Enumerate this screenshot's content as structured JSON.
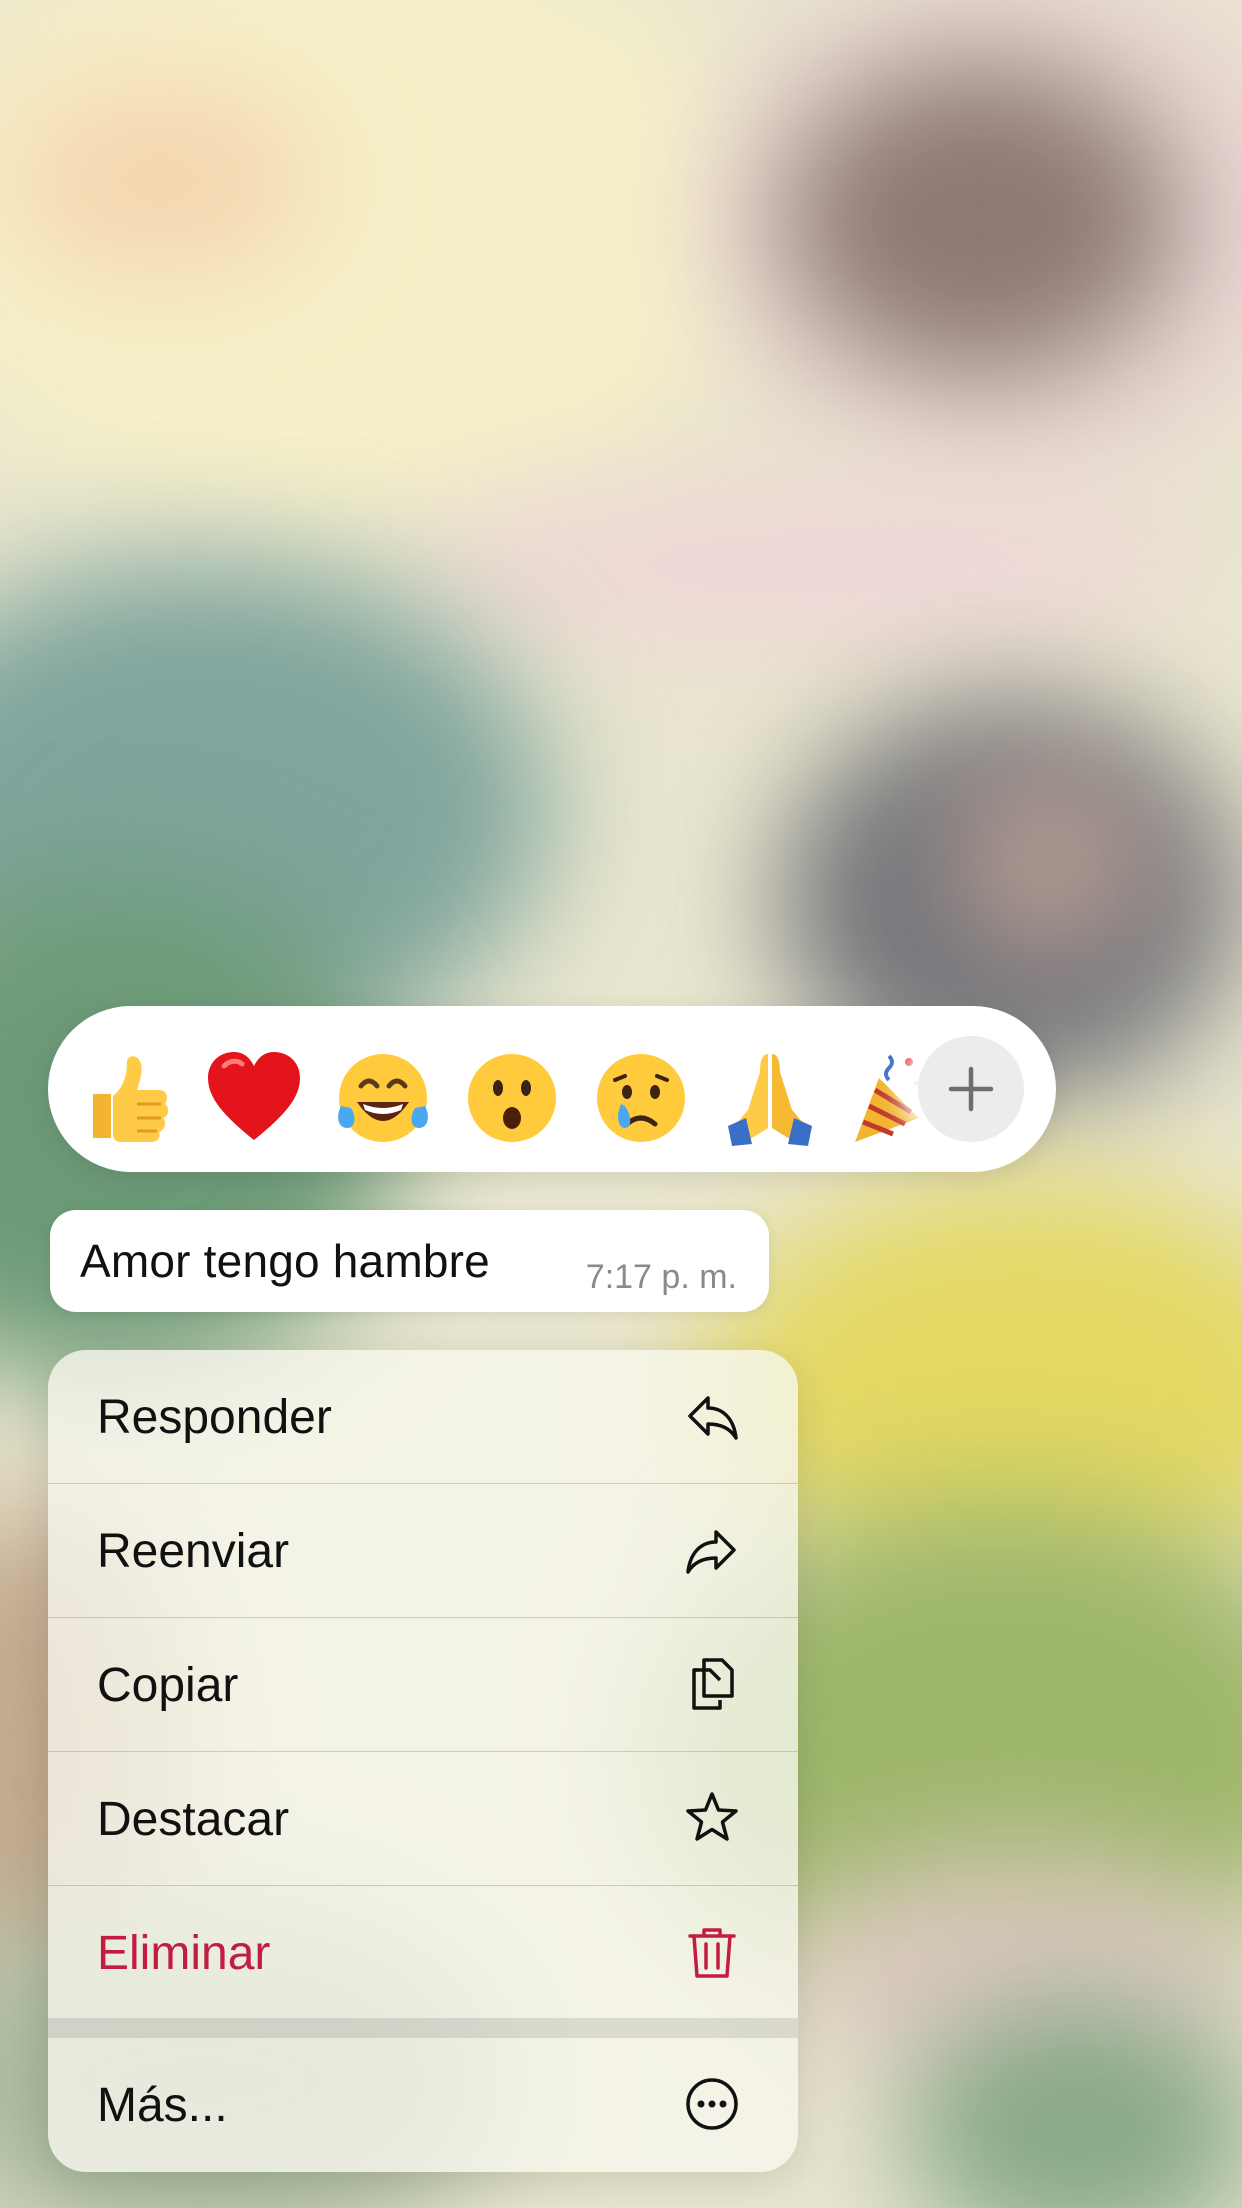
{
  "reactions": {
    "emojis": [
      "thumbs-up",
      "red-heart",
      "face-with-tears-of-joy",
      "face-with-open-mouth",
      "crying-face",
      "folded-hands",
      "party-popper"
    ],
    "more_icon": "plus-icon"
  },
  "message": {
    "text": "Amor tengo hambre",
    "time": "7:17 p. m."
  },
  "menu": {
    "items": [
      {
        "label": "Responder",
        "icon": "reply-icon"
      },
      {
        "label": "Reenviar",
        "icon": "forward-icon"
      },
      {
        "label": "Copiar",
        "icon": "copy-icon"
      },
      {
        "label": "Destacar",
        "icon": "star-icon"
      },
      {
        "label": "Eliminar",
        "icon": "trash-icon"
      },
      {
        "label": "Más...",
        "icon": "more-icon"
      }
    ]
  },
  "colors": {
    "danger": "#c21c40",
    "text": "#111111",
    "timestamp": "#8a8a8a"
  }
}
